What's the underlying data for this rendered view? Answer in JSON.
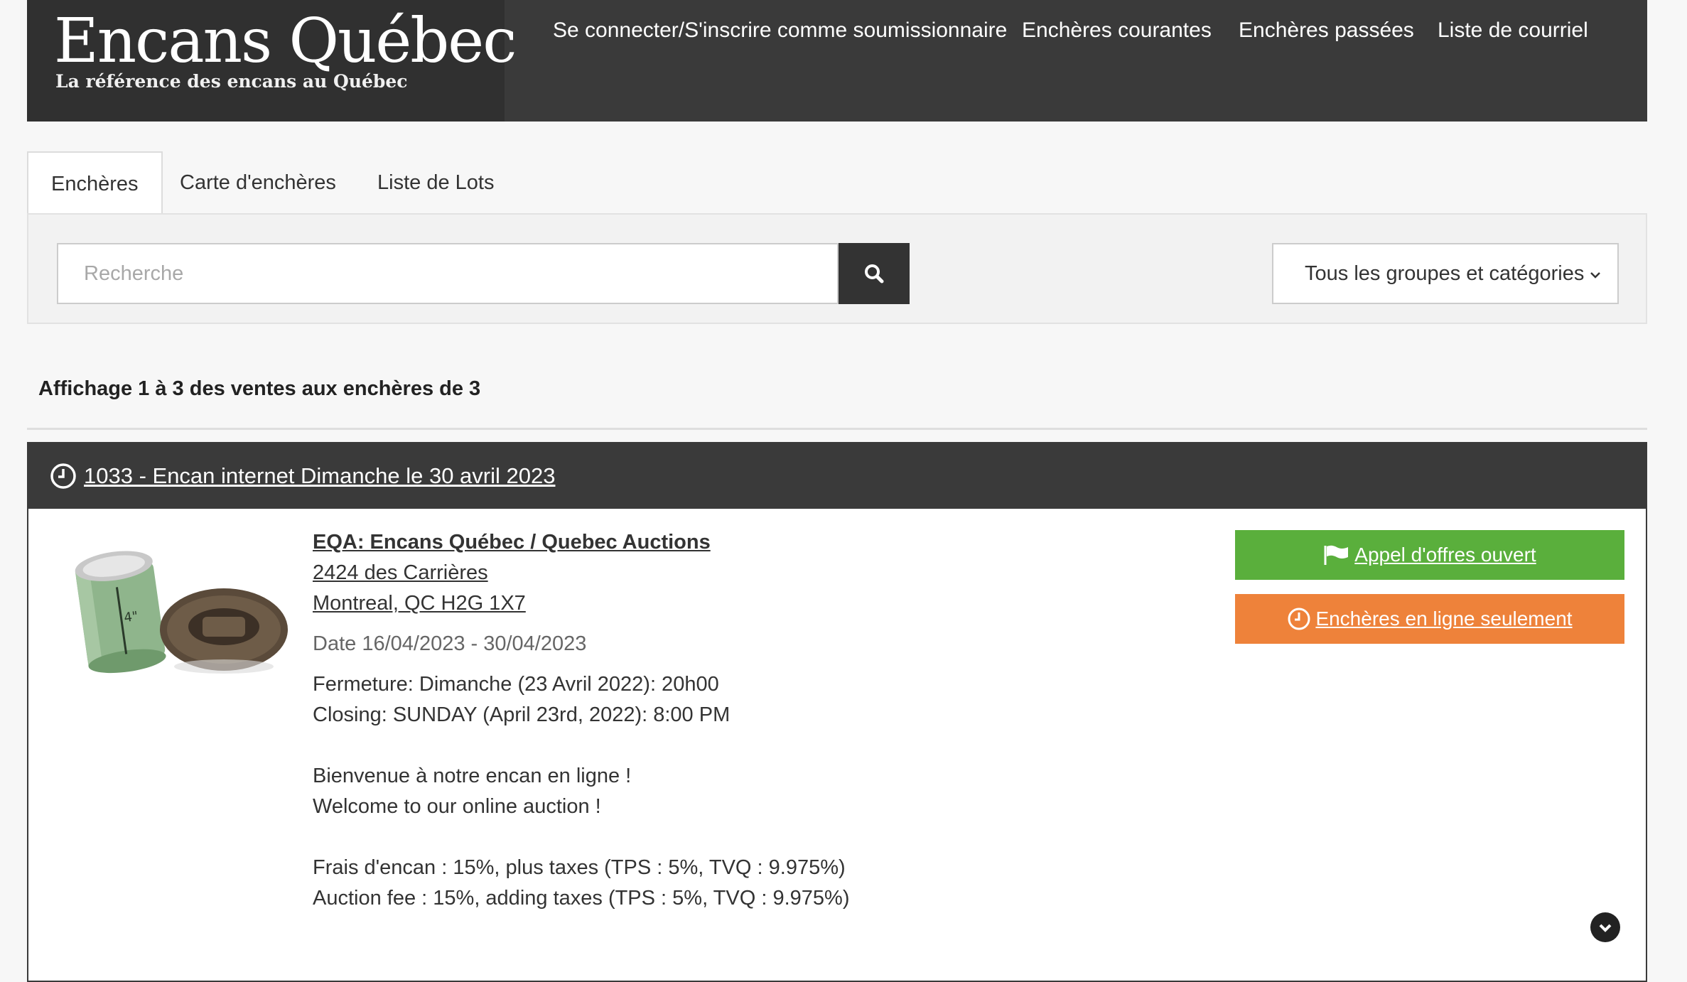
{
  "header": {
    "logo_title": "Encans Québec",
    "logo_subtitle": "La référence des encans au Québec",
    "nav": [
      {
        "label": "Se connecter/S'inscrire comme soumissionnaire"
      },
      {
        "label": "Enchères courantes"
      },
      {
        "label": "Enchères passées"
      },
      {
        "label": "Liste de courriel"
      }
    ]
  },
  "tabs": [
    {
      "label": "Enchères",
      "active": true
    },
    {
      "label": "Carte d'enchères",
      "active": false
    },
    {
      "label": "Liste de Lots",
      "active": false
    }
  ],
  "search": {
    "placeholder": "Recherche",
    "value": "",
    "button_icon": "search-icon",
    "category_select": "Tous les groupes et catégories"
  },
  "results": {
    "count_text": "Affichage 1 à 3 des ventes aux enchères de 3"
  },
  "auction": {
    "title": "1033 - Encan internet Dimanche le 30 avril 2023",
    "title_icon": "clock-icon",
    "company": "EQA: Encans Québec / Quebec Auctions",
    "address_line1": "2424 des Carrières",
    "address_line2": "Montreal, QC H2G 1X7",
    "date": "Date 16/04/2023 - 30/04/2023",
    "description": {
      "closing_fr": "Fermeture: Dimanche (23 Avril 2022): 20h00",
      "closing_en": "Closing: SUNDAY (April 23rd, 2022): 8:00 PM",
      "welcome_fr": "Bienvenue à notre encan en ligne !",
      "welcome_en": "Welcome to our online auction !",
      "fee_fr": "Frais d'encan : 15%, plus taxes (TPS : 5%, TVQ : 9.975%)",
      "fee_en": "Auction fee : 15%, adding taxes (TPS : 5%, TVQ : 9.975%)"
    },
    "buttons": {
      "open_bid": "Appel d'offres ouvert",
      "online_only": "Enchères en ligne seulement"
    }
  },
  "colors": {
    "header_bg": "#3a3a3a",
    "green": "#5aaf3c",
    "orange": "#ee823a"
  }
}
